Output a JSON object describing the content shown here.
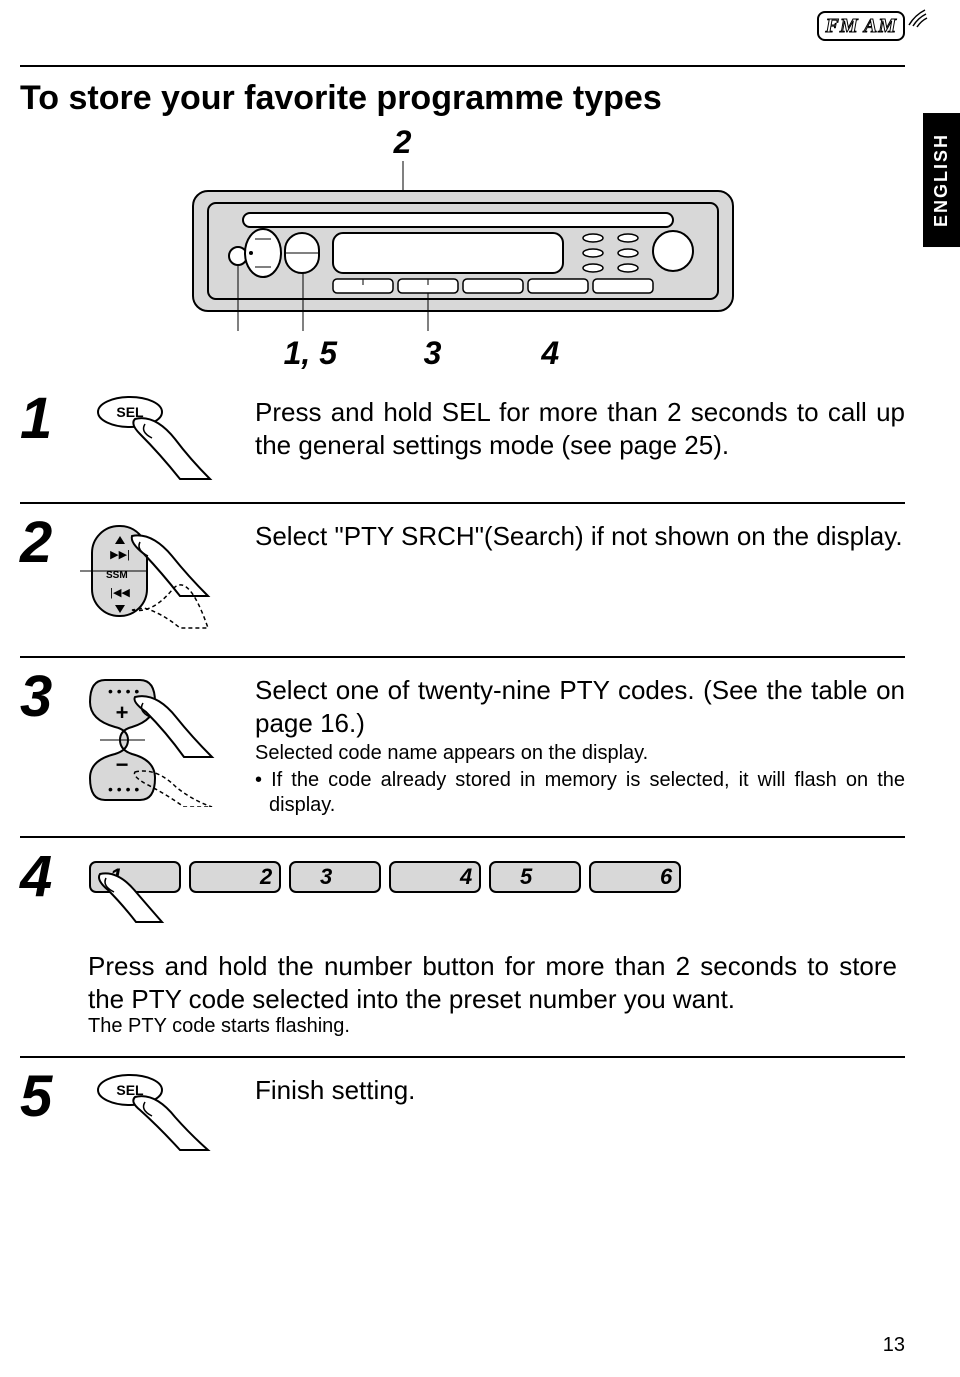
{
  "badge": {
    "fm_am": "FM  AM"
  },
  "title": "To store your favorite programme types",
  "language_tab": "ENGLISH",
  "diagram": {
    "callout_top": "2",
    "callout_bottom_left": "1, 5",
    "callout_bottom_mid": "3",
    "callout_bottom_right": "4"
  },
  "steps": {
    "s1": {
      "num": "1",
      "icon_label": "SEL",
      "text": "Press and hold SEL for more than 2 seconds to call up the general settings mode (see page 25)."
    },
    "s2": {
      "num": "2",
      "icon_label": "SSM",
      "text": "Select \"PTY SRCH\"(Search) if not shown on the display."
    },
    "s3": {
      "num": "3",
      "main": "Select one of twenty-nine PTY codes. (See the table on page 16.)",
      "sub": "Selected code name appears on the display.",
      "bullet": "• If the code already stored in memory is selected, it will flash on the display."
    },
    "s4": {
      "num": "4",
      "buttons": [
        "1",
        "2",
        "3",
        "4",
        "5",
        "6"
      ],
      "main": "Press and hold the number button for more than 2 seconds to store the PTY code selected into the preset number you want.",
      "sub": "The PTY code starts flashing."
    },
    "s5": {
      "num": "5",
      "icon_label": "SEL",
      "text": "Finish setting."
    }
  },
  "page_number": "13"
}
